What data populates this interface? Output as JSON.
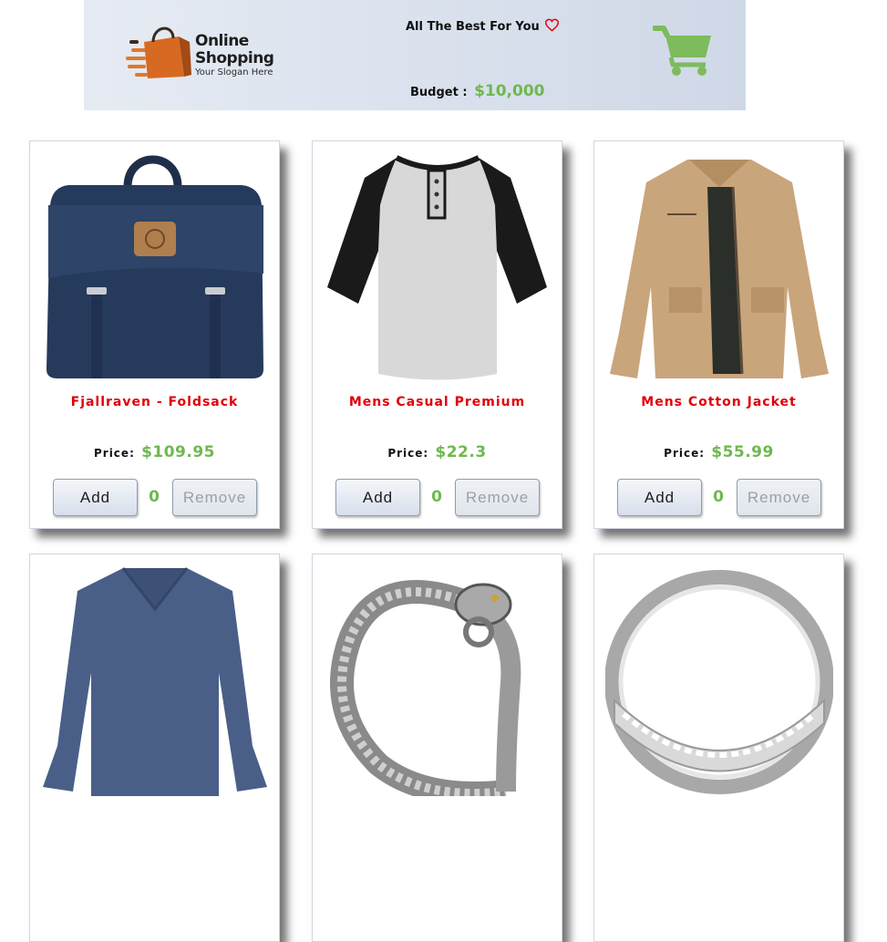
{
  "header": {
    "logo_title_line1": "Online",
    "logo_title_line2": "Shopping",
    "logo_slogan": "Your Slogan Here",
    "tagline": "All The Best For You",
    "budget_label": "Budget :",
    "budget_value": "$10,000",
    "accent_color": "#6fb84f",
    "heart_color": "#e0000a"
  },
  "products": [
    {
      "name": "Fjallraven - Foldsack",
      "price_label": "Price:",
      "price": "$109.95",
      "add_label": "Add",
      "quantity": "0",
      "remove_label": "Remove",
      "image": "navy-backpack"
    },
    {
      "name": "Mens Casual Premium",
      "price_label": "Price:",
      "price": "$22.3",
      "add_label": "Add",
      "quantity": "0",
      "remove_label": "Remove",
      "image": "raglan-henley-tshirt"
    },
    {
      "name": "Mens Cotton Jacket",
      "price_label": "Price:",
      "price": "$55.99",
      "add_label": "Add",
      "quantity": "0",
      "remove_label": "Remove",
      "image": "khaki-jacket"
    },
    {
      "image": "blue-longsleeve-shirt"
    },
    {
      "image": "silver-dragon-bracelet"
    },
    {
      "image": "silver-ring"
    }
  ]
}
